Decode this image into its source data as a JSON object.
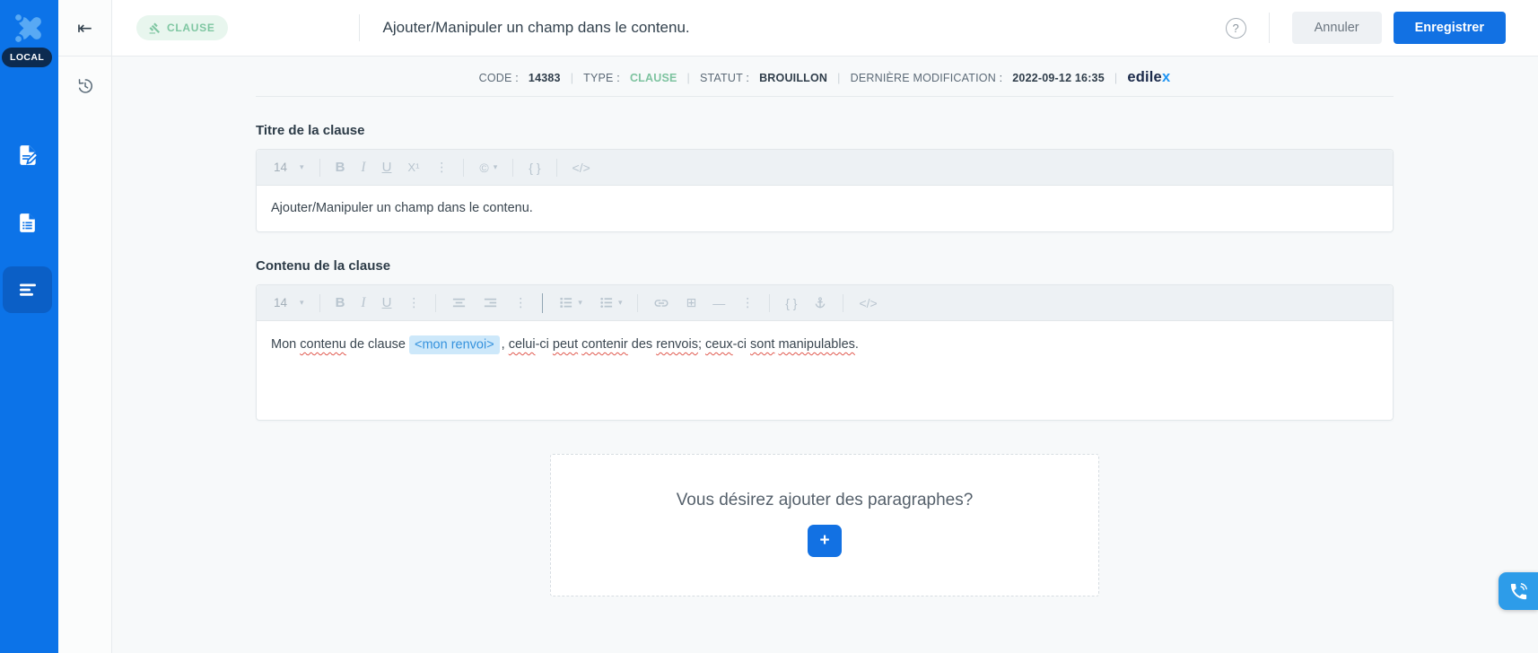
{
  "colors": {
    "sidebar_blue": "#0c73e8",
    "sidebar_active_blue": "#0b5fc6",
    "local_badge_navy": "#0c2b50",
    "logo_light_blue": "#58a9f4",
    "accent_blue": "#1271e3",
    "badge_green": "#7fc7a2",
    "badge_green_bg": "#e8f6ee",
    "chip_text_blue": "#3592dd",
    "chip_bg": "#cde8fa",
    "phone_tab_blue": "#2d9ce9",
    "spellcheck_red": "#e0584e"
  },
  "sidebar": {
    "local_badge": "LOCAL",
    "items": [
      {
        "icon": "edit-document-icon",
        "active": false
      },
      {
        "icon": "document-icon",
        "active": false
      },
      {
        "icon": "list-lines-icon",
        "active": true
      }
    ]
  },
  "rail": {
    "collapse_icon": "⇤"
  },
  "header": {
    "badge_label": "CLAUSE",
    "title": "Ajouter/Manipuler un champ dans le contenu.",
    "help_label": "?",
    "cancel_label": "Annuler",
    "save_label": "Enregistrer"
  },
  "metadata": {
    "code_label": "CODE :",
    "code_value": "14383",
    "type_label": "TYPE :",
    "type_value": "CLAUSE",
    "status_label": "STATUT :",
    "status_value": "BROUILLON",
    "modified_label": "DERNIÈRE MODIFICATION :",
    "modified_value": "2022-09-12 16:35",
    "separator": "|",
    "logo_main": "edile",
    "logo_x": "x"
  },
  "title_section": {
    "label": "Titre de la clause",
    "value": "Ajouter/Manipuler un champ dans le contenu."
  },
  "content_section": {
    "label": "Contenu de la clause",
    "sentence": {
      "t1": "Mon ",
      "t2": "contenu",
      "t3": " de clause ",
      "chip": "<mon renvoi>",
      "t4": ", ",
      "t5": "celui",
      "t6": "-ci ",
      "t7": "peut",
      "t8": " ",
      "t9": "contenir",
      "t10": " des ",
      "t11": "renvois",
      "t12": "; ",
      "t13": "ceux",
      "t14": "-ci ",
      "t15": "sont",
      "t16": " ",
      "t17": "manipulables",
      "t18": "."
    }
  },
  "toolbar": {
    "font_size": "14",
    "caret": "▾",
    "bold": "B",
    "italic": "I",
    "underline": "U",
    "superscript": "X¹",
    "overflow": "⋮",
    "copyright": "©",
    "braces": "{ }",
    "code": "</>",
    "minus": "—",
    "table": "⊞"
  },
  "paragraphs_box": {
    "prompt": "Vous désirez ajouter des paragraphes?",
    "add_label": "+"
  }
}
